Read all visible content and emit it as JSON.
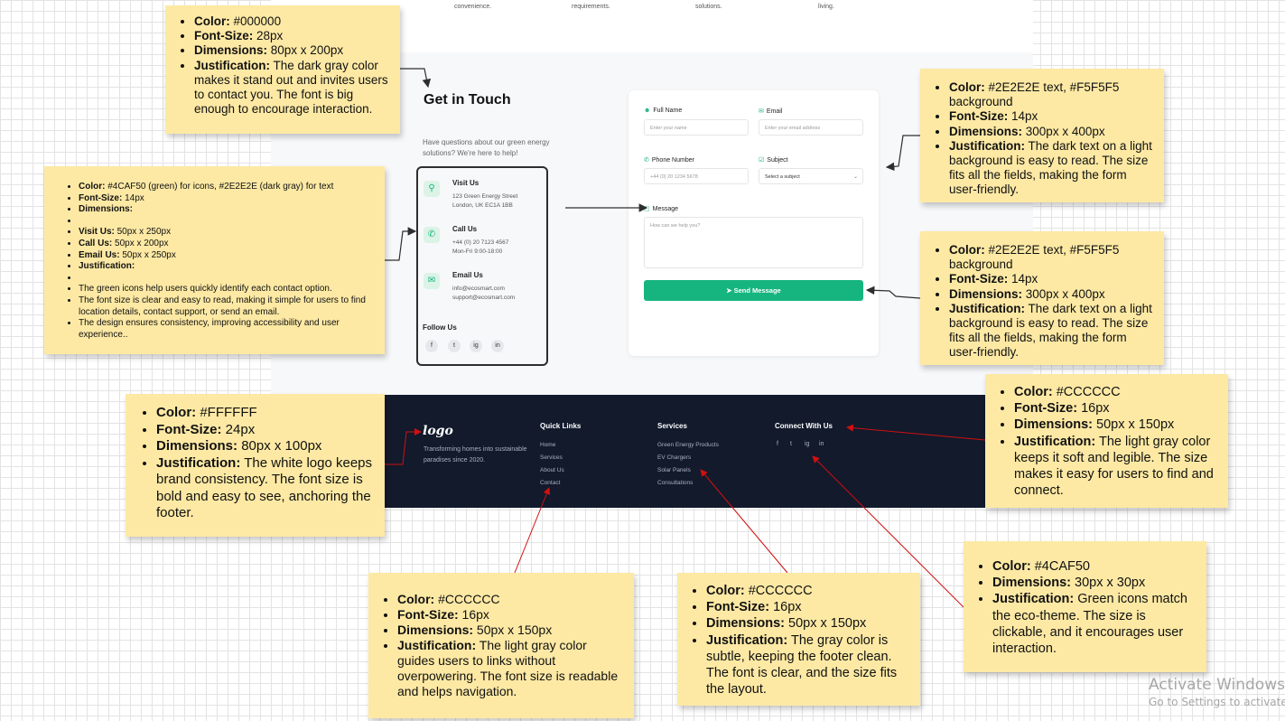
{
  "top_strip": {
    "labels": [
      "convenience.",
      "requirements.",
      "solutions.",
      "living."
    ]
  },
  "contact": {
    "title": "Get in Touch",
    "intro": "Have questions about our green energy solutions? We're here to help!",
    "items": [
      {
        "icon": "location-pin-icon",
        "title": "Visit Us",
        "lines": [
          "123 Green Energy Street",
          "London, UK EC1A 1BB"
        ]
      },
      {
        "icon": "phone-icon",
        "title": "Call Us",
        "lines": [
          "+44 (0) 20 7123 4567",
          "Mon-Fri 9:00-18:00"
        ]
      },
      {
        "icon": "mail-icon",
        "title": "Email Us",
        "lines": [
          "info@ecosmart.com",
          "support@ecosmart.com"
        ]
      }
    ],
    "follow_label": "Follow Us",
    "social": [
      "f",
      "t",
      "ig",
      "in"
    ]
  },
  "form": {
    "full_name_label": "Full Name",
    "full_name_placeholder": "Enter your name",
    "email_label": "Email",
    "email_placeholder": "Enter your email address",
    "phone_label": "Phone Number",
    "phone_placeholder": "+44 (0) 20 1234 5678",
    "subject_label": "Subject",
    "subject_value": "Select a subject",
    "message_label": "Message",
    "message_placeholder": "How can we help you?",
    "send_label": "Send Message"
  },
  "footer": {
    "logo": "logo",
    "tagline": "Transforming homes into sustainable paradises since 2020.",
    "quick_links_title": "Quick Links",
    "quick_links": [
      "Home",
      "Services",
      "About Us",
      "Contact"
    ],
    "services_title": "Services",
    "services": [
      "Green Energy Products",
      "EV Chargers",
      "Solar Panels",
      "Consultations"
    ],
    "connect_title": "Connect With Us",
    "connect_social": [
      "f",
      "t",
      "ig",
      "in"
    ]
  },
  "notes": {
    "title_note": {
      "color_label": "Color:",
      "color": "#000000",
      "size_label": "Font-Size:",
      "size": "28px",
      "dim_label": "Dimensions:",
      "dim": "80px x 200px",
      "just_label": "Justification:",
      "just": "The dark gray color makes it stand out and invites users to contact you. The font is big enough to encourage interaction."
    },
    "contact_note": {
      "color_label": "Color:",
      "color": "#4CAF50 (green) for icons, #2E2E2E (dark gray) for text",
      "size_label": "Font-Size:",
      "size": "14px",
      "dim_label": "Dimensions:",
      "visit_label": "Visit Us:",
      "visit": "50px x 250px",
      "call_label": "Call Us:",
      "call": "50px x 200px",
      "email_label": "Email Us:",
      "email": "50px x 250px",
      "just_label": "Justification:",
      "j1": "The green icons help users quickly identify each contact option.",
      "j2": "The font size is clear and easy to read, making it simple for users to find location details, contact support, or send an email.",
      "j3": "The design ensures consistency, improving accessibility and user experience.."
    },
    "form_note_1": {
      "color_label": "Color:",
      "color": "#2E2E2E text, #F5F5F5 background",
      "size_label": "Font-Size:",
      "size": "14px",
      "dim_label": "Dimensions:",
      "dim": "300px x 400px",
      "just_label": "Justification:",
      "just": "The dark text on a light background is easy to read. The size fits all the fields, making the form user-friendly."
    },
    "form_note_2": {
      "color_label": "Color:",
      "color": "#2E2E2E text, #F5F5F5 background",
      "size_label": "Font-Size:",
      "size": "14px",
      "dim_label": "Dimensions:",
      "dim": "300px x 400px",
      "just_label": "Justification:",
      "just": "The dark text on a light background is easy to read. The size fits all the fields, making the form user-friendly."
    },
    "logo_note": {
      "color_label": "Color:",
      "color": "#FFFFFF",
      "size_label": "Font-Size:",
      "size": "24px",
      "dim_label": "Dimensions:",
      "dim": "80px x 100px",
      "just_label": "Justification:",
      "just": "The white logo keeps brand consistency. The font size is bold and easy to see, anchoring the footer."
    },
    "connect_note": {
      "color_label": "Color:",
      "color": "#CCCCCC",
      "size_label": "Font-Size:",
      "size": "16px",
      "dim_label": "Dimensions:",
      "dim": "50px x 150px",
      "just_label": "Justification:",
      "just": "The light gray color keeps it soft and legible. The size makes it easy for users to find and connect."
    },
    "icons_note": {
      "color_label": "Color:",
      "color": "#4CAF50",
      "dim_label": "Dimensions:",
      "dim": "30px x 30px",
      "just_label": "Justification:",
      "just": "Green icons match the eco-theme. The size is clickable, and it encourages user interaction."
    },
    "quick_note": {
      "color_label": "Color:",
      "color": "#CCCCCC",
      "size_label": "Font-Size:",
      "size": "16px",
      "dim_label": "Dimensions:",
      "dim": "50px x 150px",
      "just_label": "Justification:",
      "just": "The light gray color guides users to links without overpowering. The font size is readable and helps navigation."
    },
    "services_note": {
      "color_label": "Color:",
      "color": "#CCCCCC",
      "size_label": "Font-Size:",
      "size": "16px",
      "dim_label": "Dimensions:",
      "dim": "50px x 150px",
      "just_label": "Justification:",
      "just": "The gray color is subtle, keeping the footer clean. The font is clear, and the size fits the layout."
    }
  },
  "watermark": {
    "line1": "Activate Windows",
    "line2": "Go to Settings to activate Windows."
  }
}
